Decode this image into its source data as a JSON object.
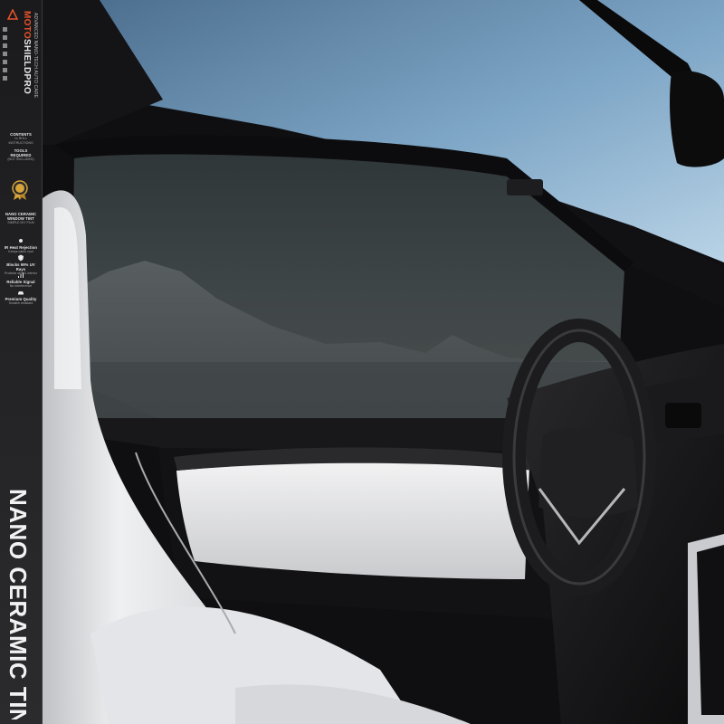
{
  "product_strip": {
    "brand_name_part1": "MOTO",
    "brand_name_part2": "SHIELD",
    "brand_name_part3": "PRO",
    "brand_tagline": "ADVANCED NANO-TECH AUTO CARE",
    "contents_heading": "CONTENTS",
    "contents_text": "1x ROLL INSTRUCTIONS",
    "tools_heading": "TOOLS REQUIRED",
    "tools_text": "(NOT INCLUDED)",
    "product_heading_line1": "NANO CERAMIC",
    "product_heading_line2": "WINDOW TINT",
    "product_subtext": "SIMPLE DIY FILM",
    "features": [
      {
        "icon": "sun-icon",
        "title": "IR Heat Rejection",
        "text": "Keeps cabin cool"
      },
      {
        "icon": "shield-icon",
        "title": "Blocks 99% UV Rays",
        "text": "Protects skin & interior"
      },
      {
        "icon": "signal-icon",
        "title": "Reliable Signal",
        "text": "No interference"
      },
      {
        "icon": "car-icon",
        "title": "Premium Quality",
        "text": "Scratch resistant"
      }
    ],
    "large_label": "NANO CERAMIC TINT",
    "accent_color": "#e9532a"
  },
  "photo": {
    "subject": "car-interior-with-tinted-window",
    "accent_colors": {
      "sky": "#7fa7c6",
      "tinted_glass": "#3c4448",
      "seat_leather": "#e9eaec",
      "dash_black": "#141416"
    }
  }
}
